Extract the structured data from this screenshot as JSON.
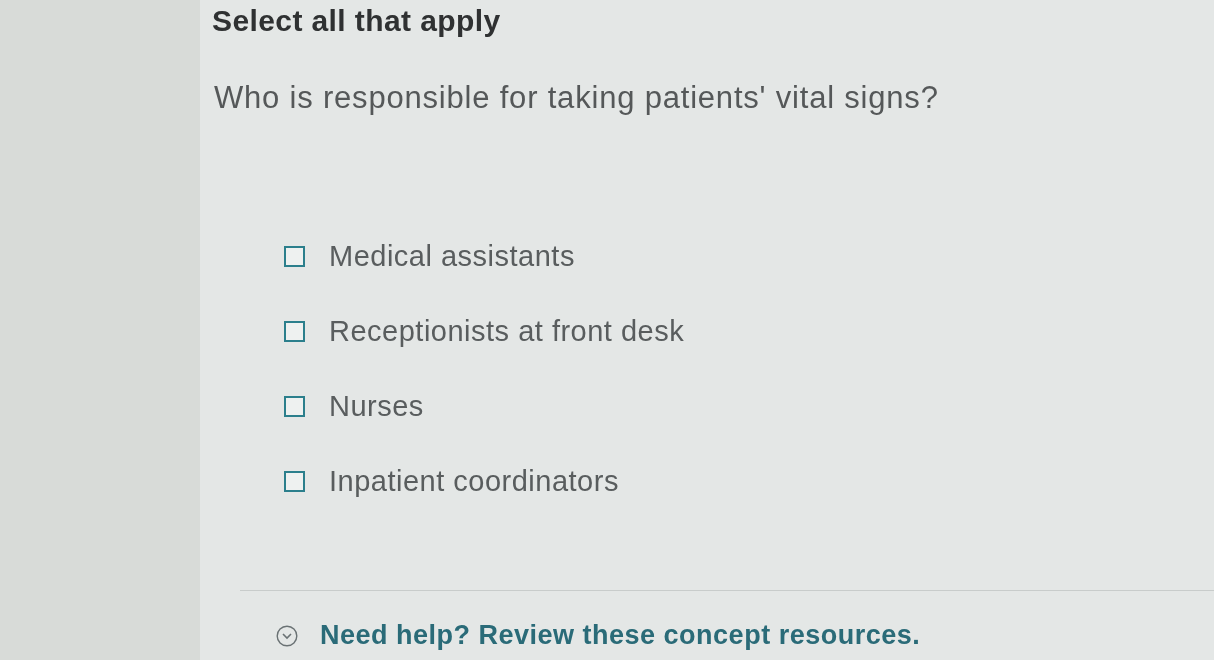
{
  "instruction": "Select all that apply",
  "question": "Who is responsible for taking patients' vital signs?",
  "options": [
    {
      "label": "Medical assistants",
      "checked": false
    },
    {
      "label": "Receptionists at front desk",
      "checked": false
    },
    {
      "label": "Nurses",
      "checked": false
    },
    {
      "label": "Inpatient coordinators",
      "checked": false
    }
  ],
  "help": {
    "text": "Need help? Review these concept resources.",
    "expanded": false
  }
}
